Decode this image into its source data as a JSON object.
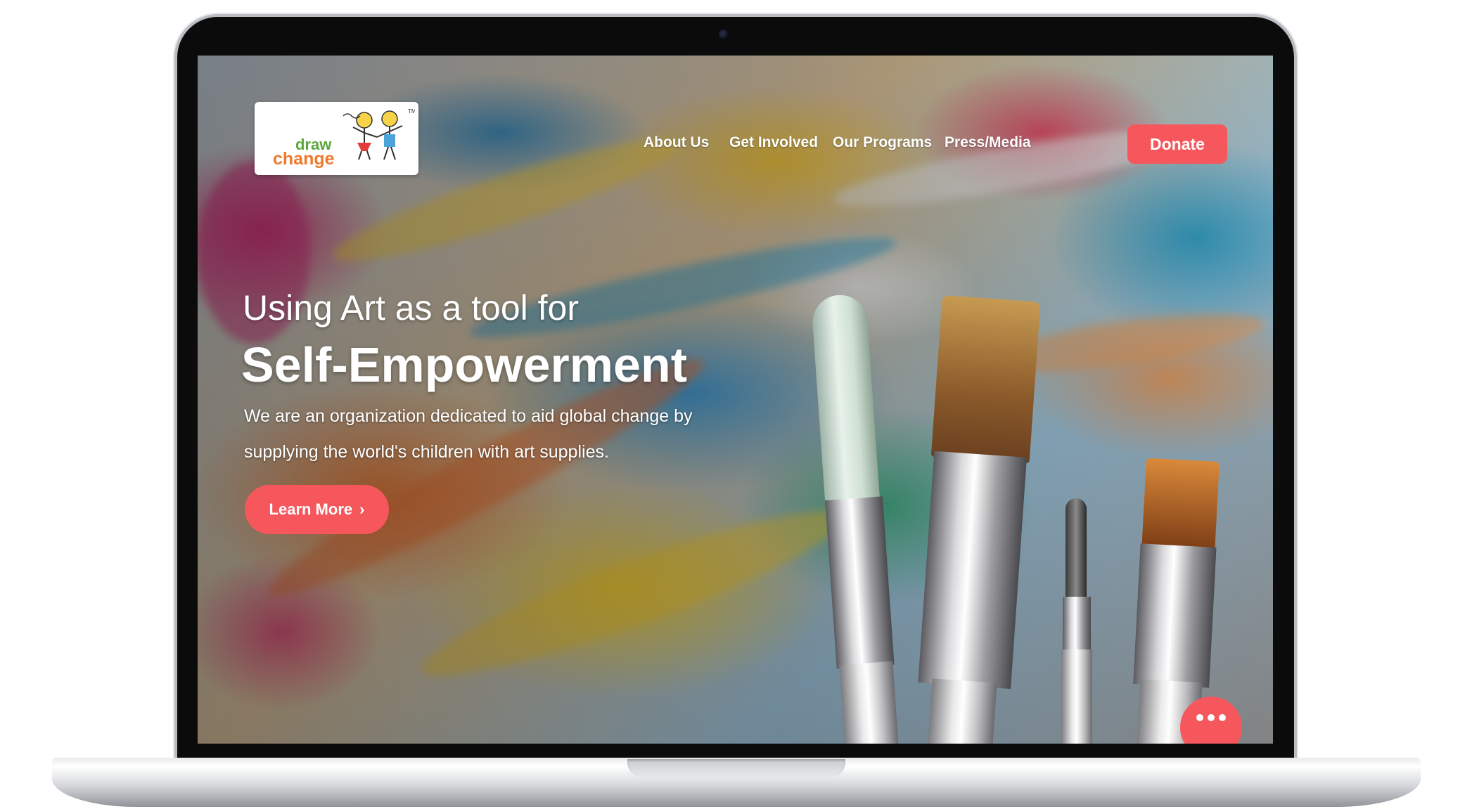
{
  "logo": {
    "line1": "draw",
    "line2": "change",
    "icon": "stick-figure-kids-icon"
  },
  "nav": {
    "items": [
      {
        "label": "About Us"
      },
      {
        "label": "Get Involved"
      },
      {
        "label": "Our Programs"
      },
      {
        "label": "Press/Media"
      }
    ],
    "donate_label": "Donate"
  },
  "hero": {
    "pretitle": "Using Art as a tool for",
    "title": "Self-Empowerment",
    "description_line1": "We are an organization dedicated to aid global change by",
    "description_line2": "supplying the world's children with art supplies.",
    "cta_label": "Learn More",
    "cta_icon": "chevron-right-icon"
  },
  "chat": {
    "icon": "more-dots-icon"
  },
  "colors": {
    "accent": "#f5575d",
    "logo_green": "#5aa83a",
    "logo_orange": "#ef7a2b",
    "text": "#ffffff"
  }
}
